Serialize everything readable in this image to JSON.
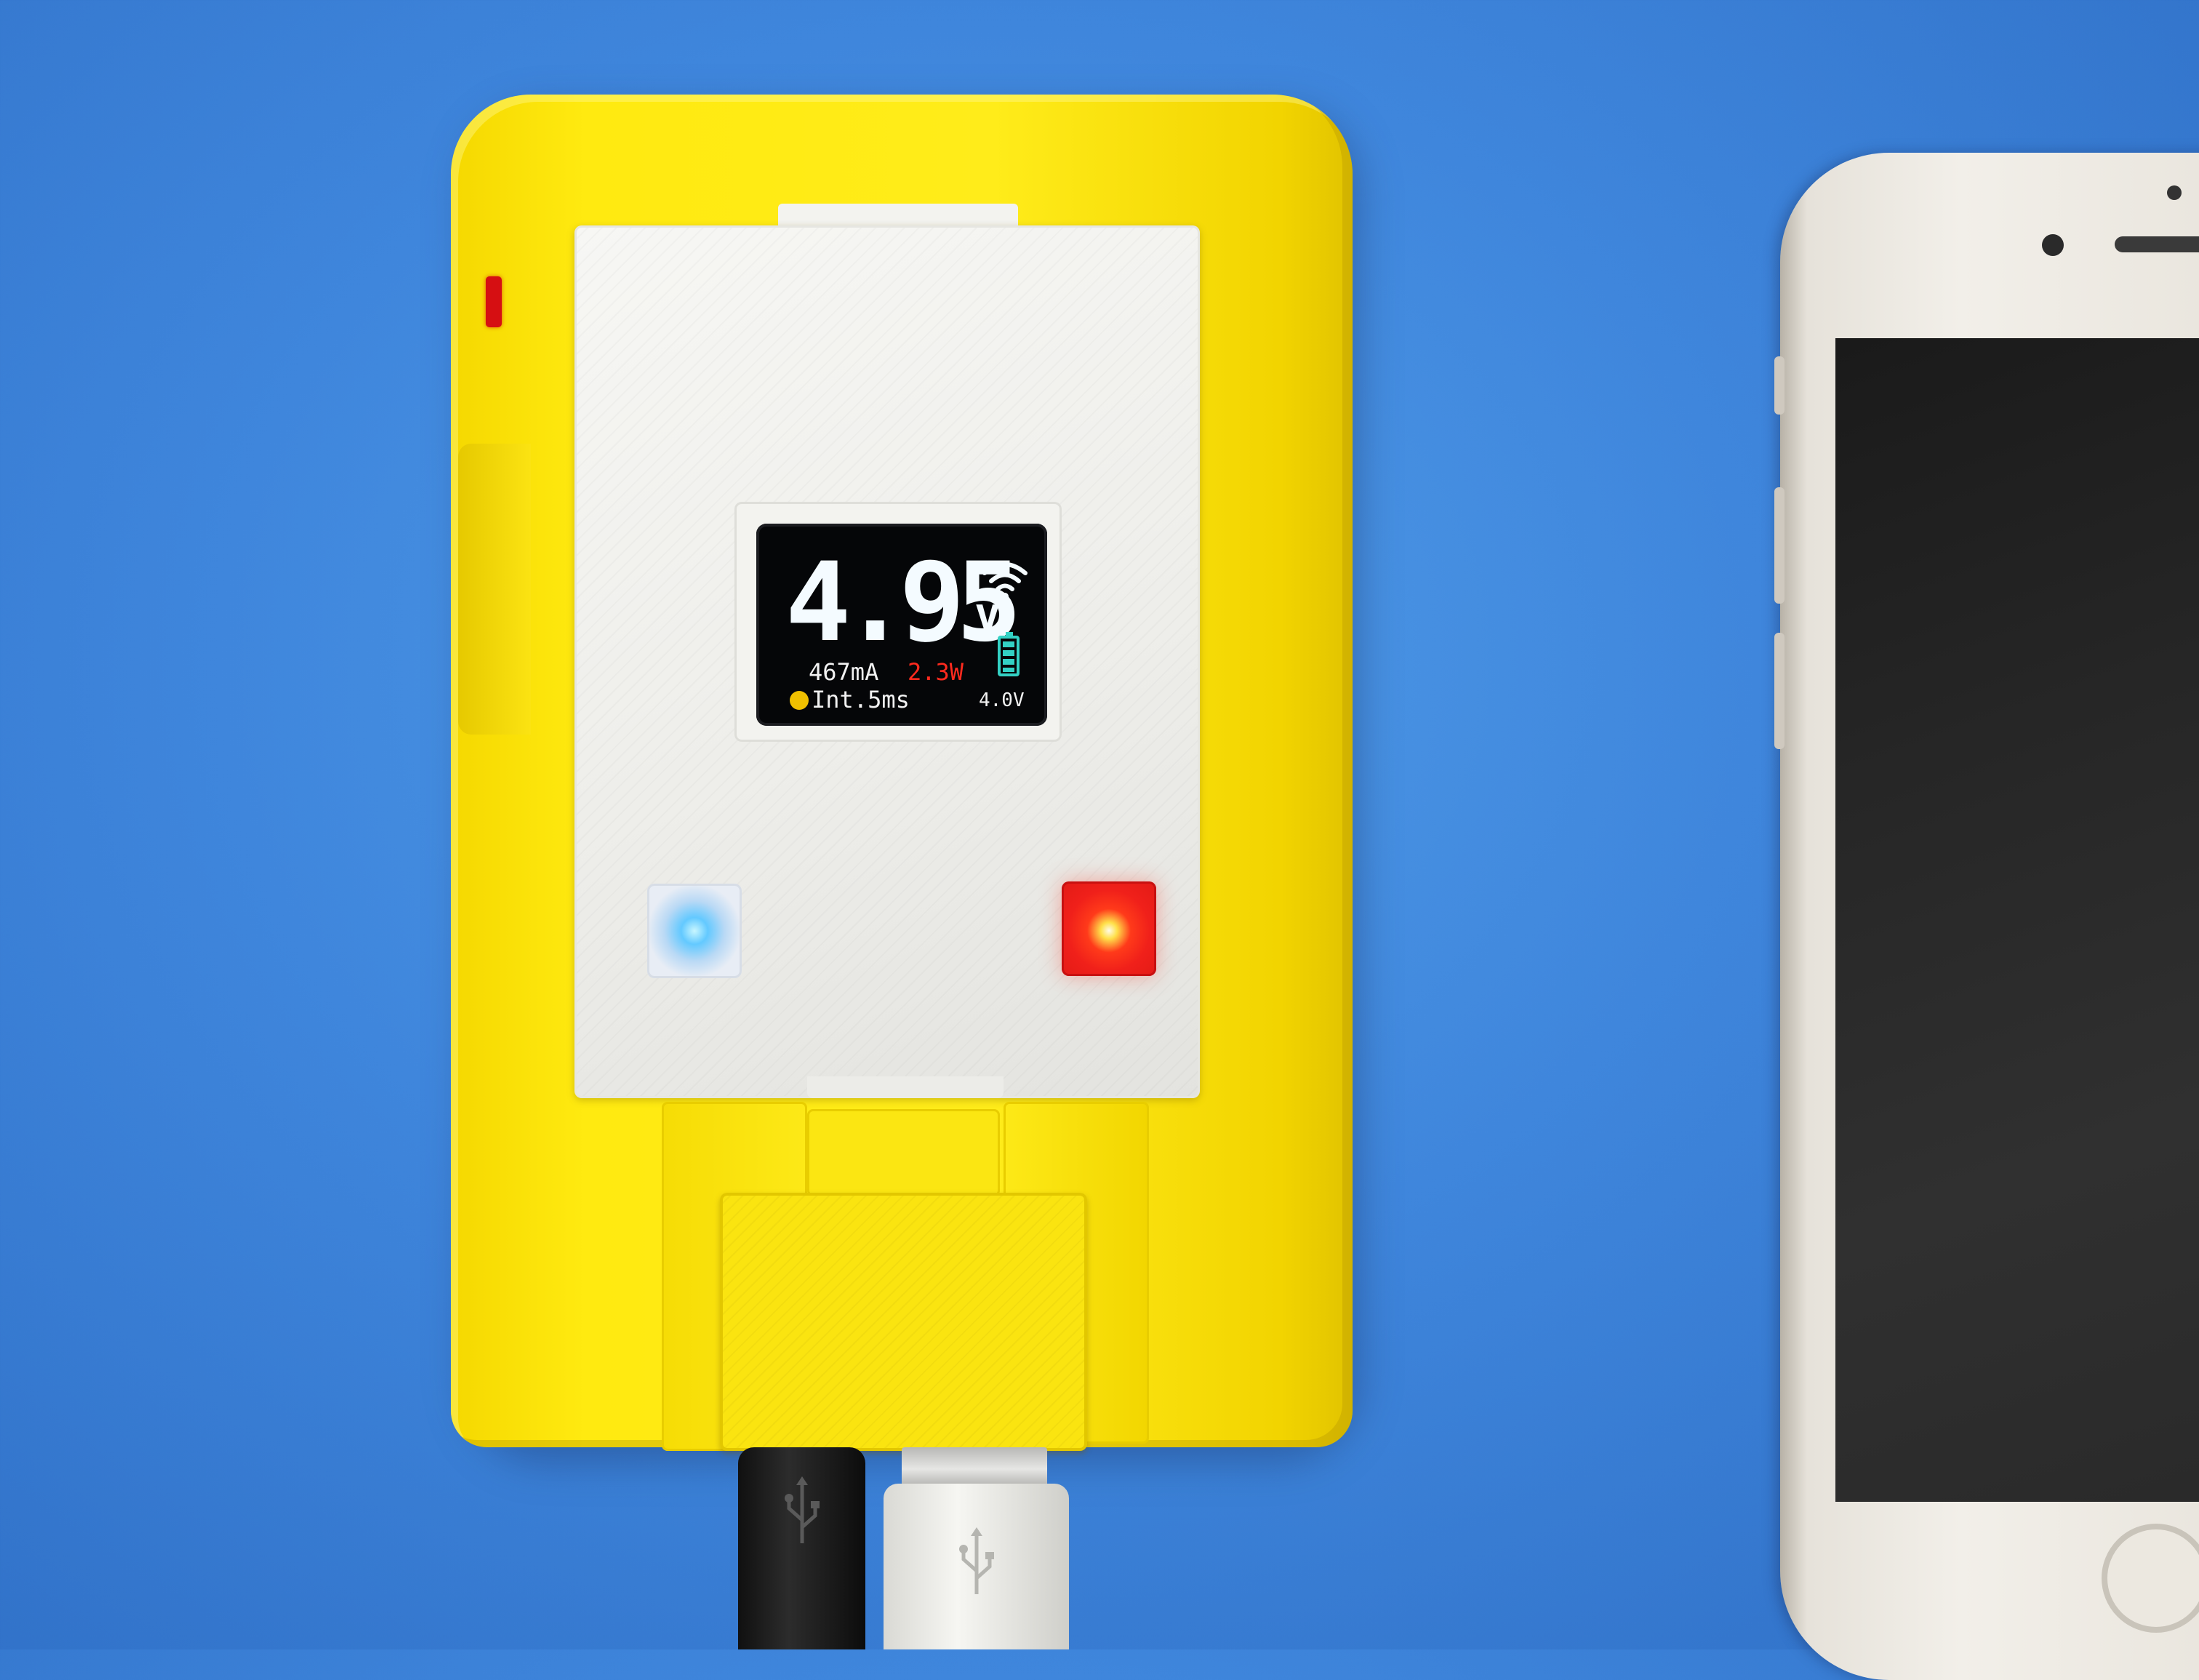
{
  "device": {
    "screen": {
      "voltage": "4.95",
      "voltage_unit": "v",
      "current": "467mA",
      "power": "2.3W",
      "interval": "Int.5ms",
      "cell_voltage": "4.0V"
    },
    "colors": {
      "case": "#ffe814",
      "faceplate": "#f0f0ec",
      "led_left": "#35b8ff",
      "led_right": "#ff2a18",
      "power_text": "#ff2a1e",
      "battery_icon": "#33d1c4",
      "status_dot": "#f0c000"
    },
    "battery_level_fraction": 1.0
  },
  "background": {
    "color": "#3f86dc"
  }
}
